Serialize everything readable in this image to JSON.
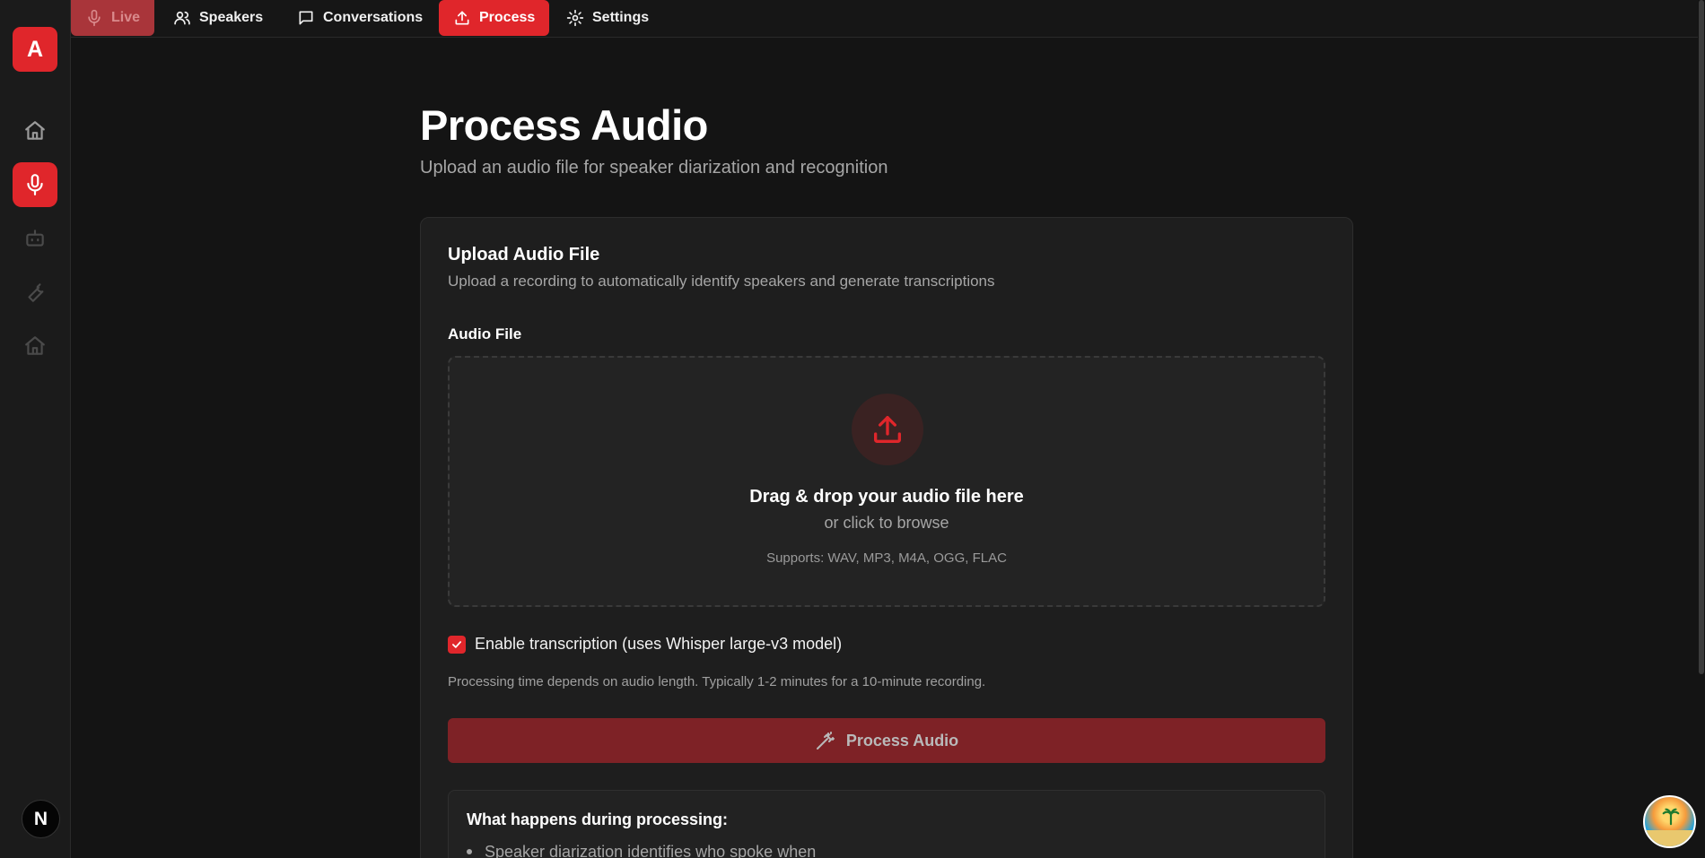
{
  "sidebar": {
    "logo_letter": "A",
    "avatar_letter": "N",
    "items": [
      {
        "name": "home-icon",
        "active": false
      },
      {
        "name": "microphone-icon",
        "active": true
      },
      {
        "name": "bot-icon",
        "active": false
      },
      {
        "name": "wrench-icon",
        "active": false
      },
      {
        "name": "home-alt-icon",
        "active": false
      }
    ]
  },
  "nav": {
    "tabs": [
      {
        "label": "Live",
        "icon": "microphone-icon"
      },
      {
        "label": "Speakers",
        "icon": "users-icon"
      },
      {
        "label": "Conversations",
        "icon": "message-square-icon"
      },
      {
        "label": "Process",
        "icon": "upload-icon"
      },
      {
        "label": "Settings",
        "icon": "gear-icon"
      }
    ],
    "active_tab": "Process"
  },
  "page": {
    "title": "Process Audio",
    "subtitle": "Upload an audio file for speaker diarization and recognition"
  },
  "card": {
    "title": "Upload Audio File",
    "description": "Upload a recording to automatically identify speakers and generate transcriptions",
    "field_label": "Audio File",
    "dropzone": {
      "main_text": "Drag & drop your audio file here",
      "sub_text": "or click to browse",
      "supports_text": "Supports: WAV, MP3, M4A, OGG, FLAC"
    },
    "transcription": {
      "label": "Enable transcription (uses Whisper large-v3 model)",
      "checked": true
    },
    "note": "Processing time depends on audio length. Typically 1-2 minutes for a 10-minute recording.",
    "process_button_label": "Process Audio",
    "info": {
      "title": "What happens during processing:",
      "items": [
        "Speaker diarization identifies who spoke when"
      ]
    }
  },
  "colors": {
    "accent": "#e0262b",
    "background": "#141414",
    "card": "#1e1e1e"
  }
}
